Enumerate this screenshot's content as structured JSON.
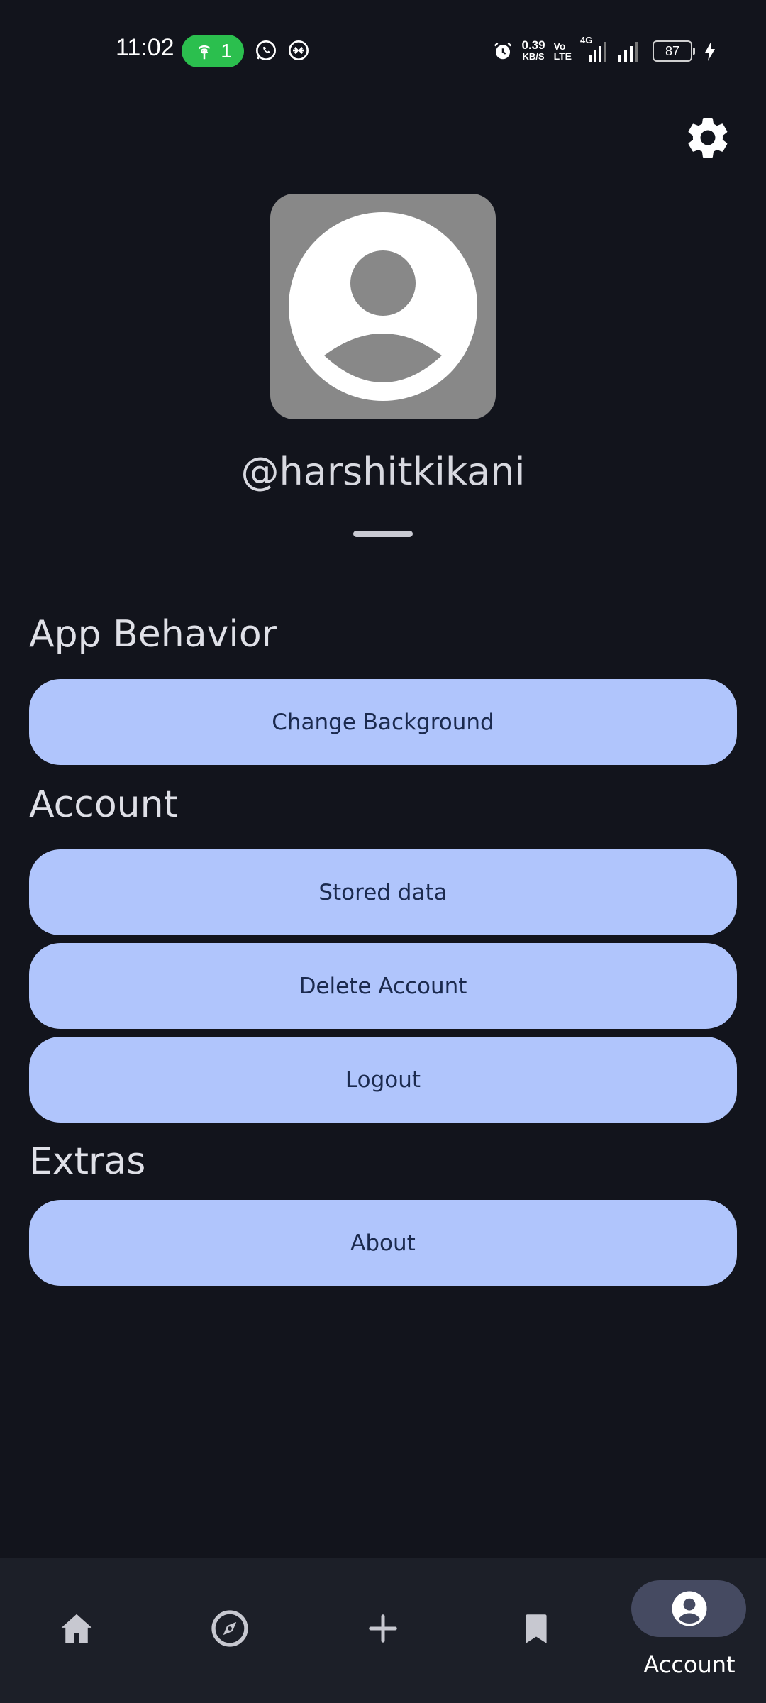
{
  "status_bar": {
    "time": "11:02",
    "hotspot_count": "1",
    "net_speed_value": "0.39",
    "net_speed_unit": "KB/S",
    "volte_top": "Vo",
    "volte_bottom": "LTE",
    "network_type": "4G",
    "battery_level": "87"
  },
  "profile": {
    "username": "@harshitkikani",
    "avatar_icon": "person-avatar-icon"
  },
  "sections": {
    "app_behavior": {
      "title": "App Behavior",
      "change_background": "Change Background"
    },
    "account": {
      "title": "Account",
      "stored_data": "Stored data",
      "delete_account": "Delete Account",
      "logout": "Logout"
    },
    "extras": {
      "title": "Extras",
      "about": "About"
    }
  },
  "bottom_nav": {
    "items": [
      {
        "icon": "home-icon",
        "label": ""
      },
      {
        "icon": "compass-icon",
        "label": ""
      },
      {
        "icon": "plus-icon",
        "label": ""
      },
      {
        "icon": "bookmark-icon",
        "label": ""
      },
      {
        "icon": "account-icon",
        "label": "Account"
      }
    ],
    "active_index": 4
  },
  "colors": {
    "background": "#12141c",
    "button_fill": "#b0c5fc",
    "button_text": "#1b2a4e",
    "nav_background": "#1c1f28",
    "nav_active_pill": "#454a61",
    "hotspot_green": "#2bbf4e"
  }
}
